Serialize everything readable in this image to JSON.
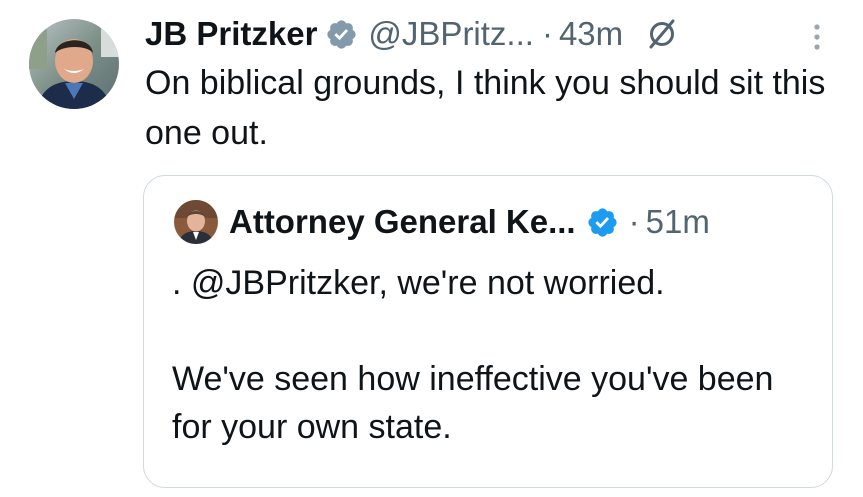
{
  "tweet": {
    "author": {
      "display_name": "JB Pritzker",
      "handle": "@JBPritz...",
      "verified": true,
      "verified_badge_color": "#829aab"
    },
    "separator": "·",
    "timestamp": "43m",
    "text": "On biblical grounds, I think you should sit this one out.",
    "icons": [
      "verified-badge-icon",
      "grok-icon",
      "more-options-icon"
    ]
  },
  "quoted_tweet": {
    "author": {
      "display_name": "Attorney General Ke...",
      "verified": true,
      "verified_badge_color": "#1d9bf0"
    },
    "separator": "·",
    "timestamp": "51m",
    "text_line_1": ". @JBPritzker, we're not worried.",
    "text_line_2": "We've seen how ineffective you've been for your own state."
  },
  "colors": {
    "text_primary": "#0f1419",
    "text_secondary": "#536471",
    "border": "#cfd9de",
    "verified_blue": "#1d9bf0",
    "verified_gray": "#829aab"
  }
}
